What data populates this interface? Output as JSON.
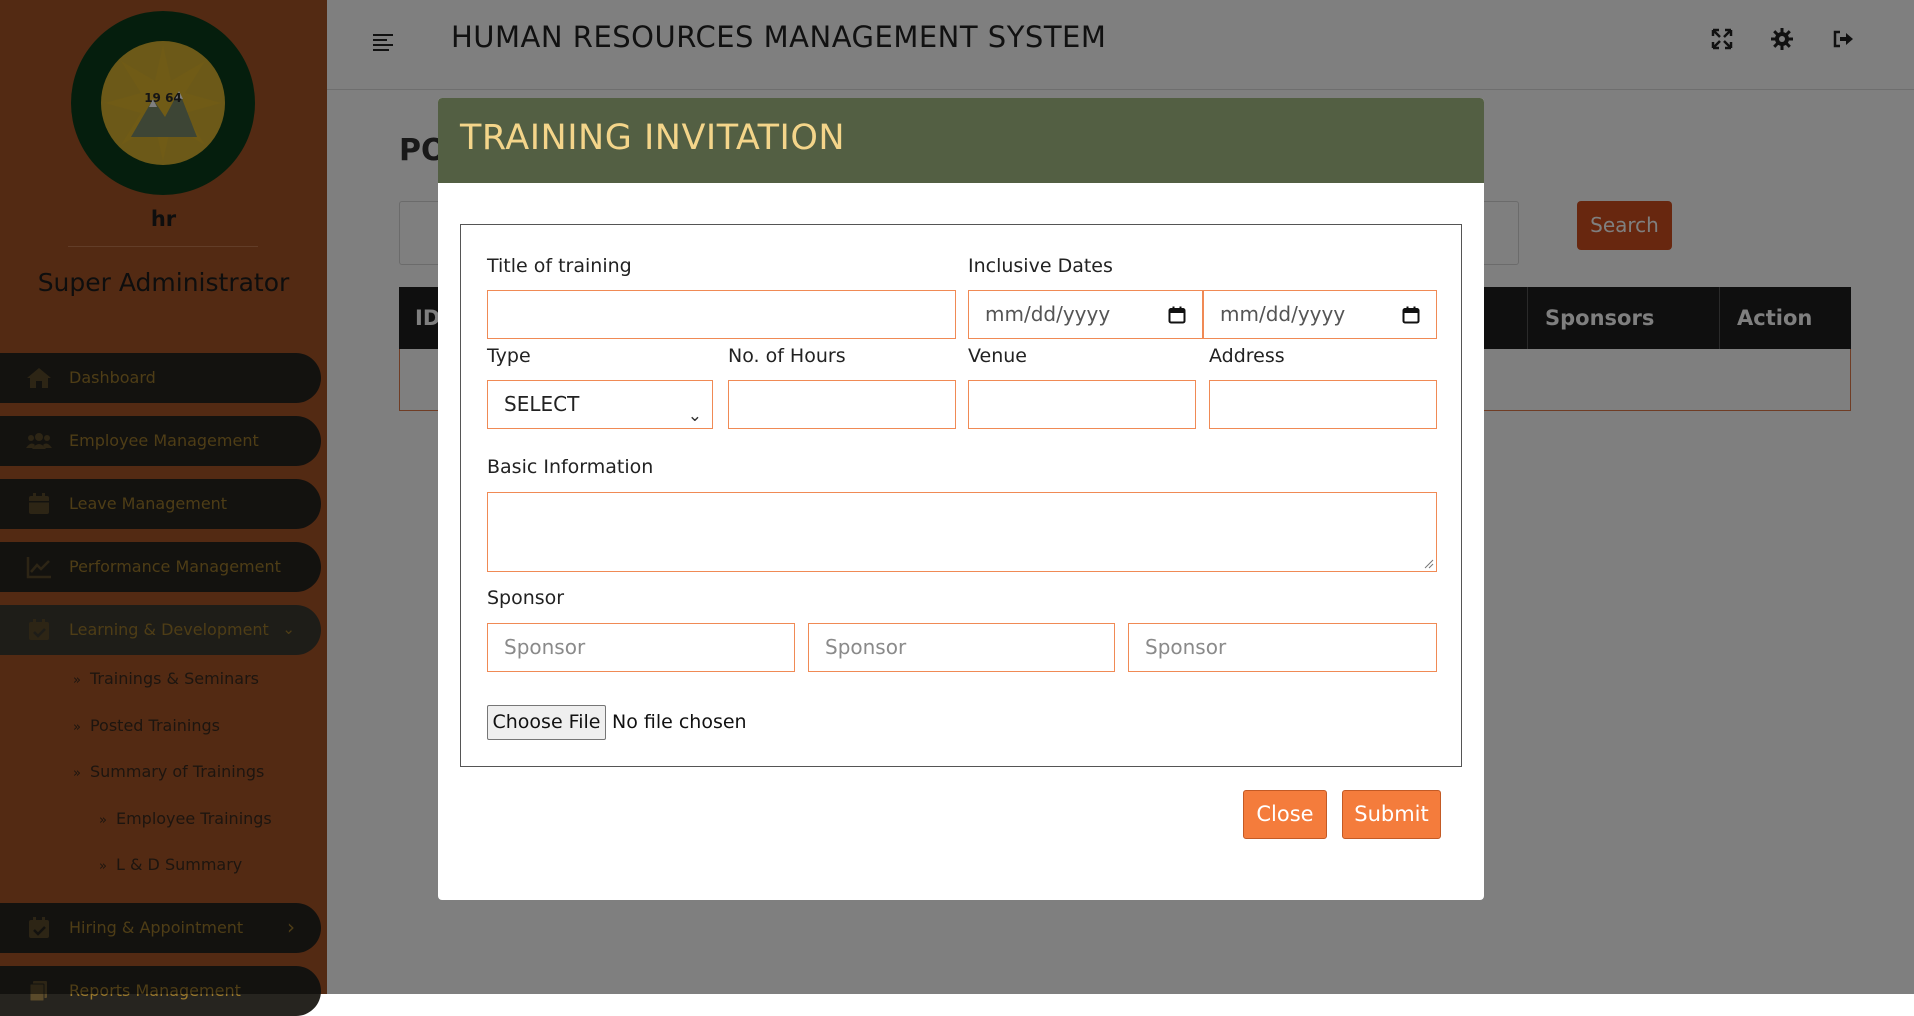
{
  "sidebar": {
    "logo_year": "19 64",
    "user_name": "hr",
    "role": "Super Administrator",
    "nav": [
      {
        "label": "Dashboard",
        "icon": "home-icon"
      },
      {
        "label": "Employee Management",
        "icon": "users-icon"
      },
      {
        "label": "Leave Management",
        "icon": "calendar-icon"
      },
      {
        "label": "Performance Management",
        "icon": "chart-line-icon"
      },
      {
        "label": "Learning & Development",
        "icon": "calendar-check-icon"
      },
      {
        "label": "Hiring & Appointment",
        "icon": "calendar-check-icon"
      },
      {
        "label": "Reports Management",
        "icon": "copy-icon"
      }
    ],
    "subnav": [
      {
        "label": "Trainings & Seminars"
      },
      {
        "label": "Posted Trainings"
      },
      {
        "label": "Summary of Trainings"
      },
      {
        "label": "Employee Trainings"
      },
      {
        "label": "L & D Summary"
      }
    ]
  },
  "topbar": {
    "title": "HUMAN RESOURCES MANAGEMENT SYSTEM"
  },
  "content": {
    "title": "PO",
    "search_label": "Search",
    "table_headers": {
      "id": "ID",
      "sponsors": "Sponsors",
      "action": "Action"
    }
  },
  "modal": {
    "title": "TRAINING INVITATION",
    "fields": {
      "title_label": "Title of training",
      "title_value": "",
      "dates_label": "Inclusive Dates",
      "date_start_placeholder": "mm/dd/yyyy",
      "date_end_placeholder": "mm/dd/yyyy",
      "type_label": "Type",
      "type_selected": "SELECT",
      "hours_label": "No. of Hours",
      "hours_value": "",
      "venue_label": "Venue",
      "venue_value": "",
      "address_label": "Address",
      "address_value": "",
      "basic_info_label": "Basic Information",
      "basic_info_value": "",
      "sponsor_label": "Sponsor",
      "sponsor_placeholders": [
        "Sponsor",
        "Sponsor",
        "Sponsor"
      ]
    },
    "file": {
      "button_label": "Choose File",
      "status": "No file chosen"
    },
    "actions": {
      "close_label": "Close",
      "submit_label": "Submit"
    }
  },
  "colors": {
    "sidebar_bg": "#a65427",
    "modal_header_bg": "#535f43",
    "modal_title": "#f4d58a",
    "field_border": "#f08a55",
    "button_bg": "#f47c3c"
  }
}
